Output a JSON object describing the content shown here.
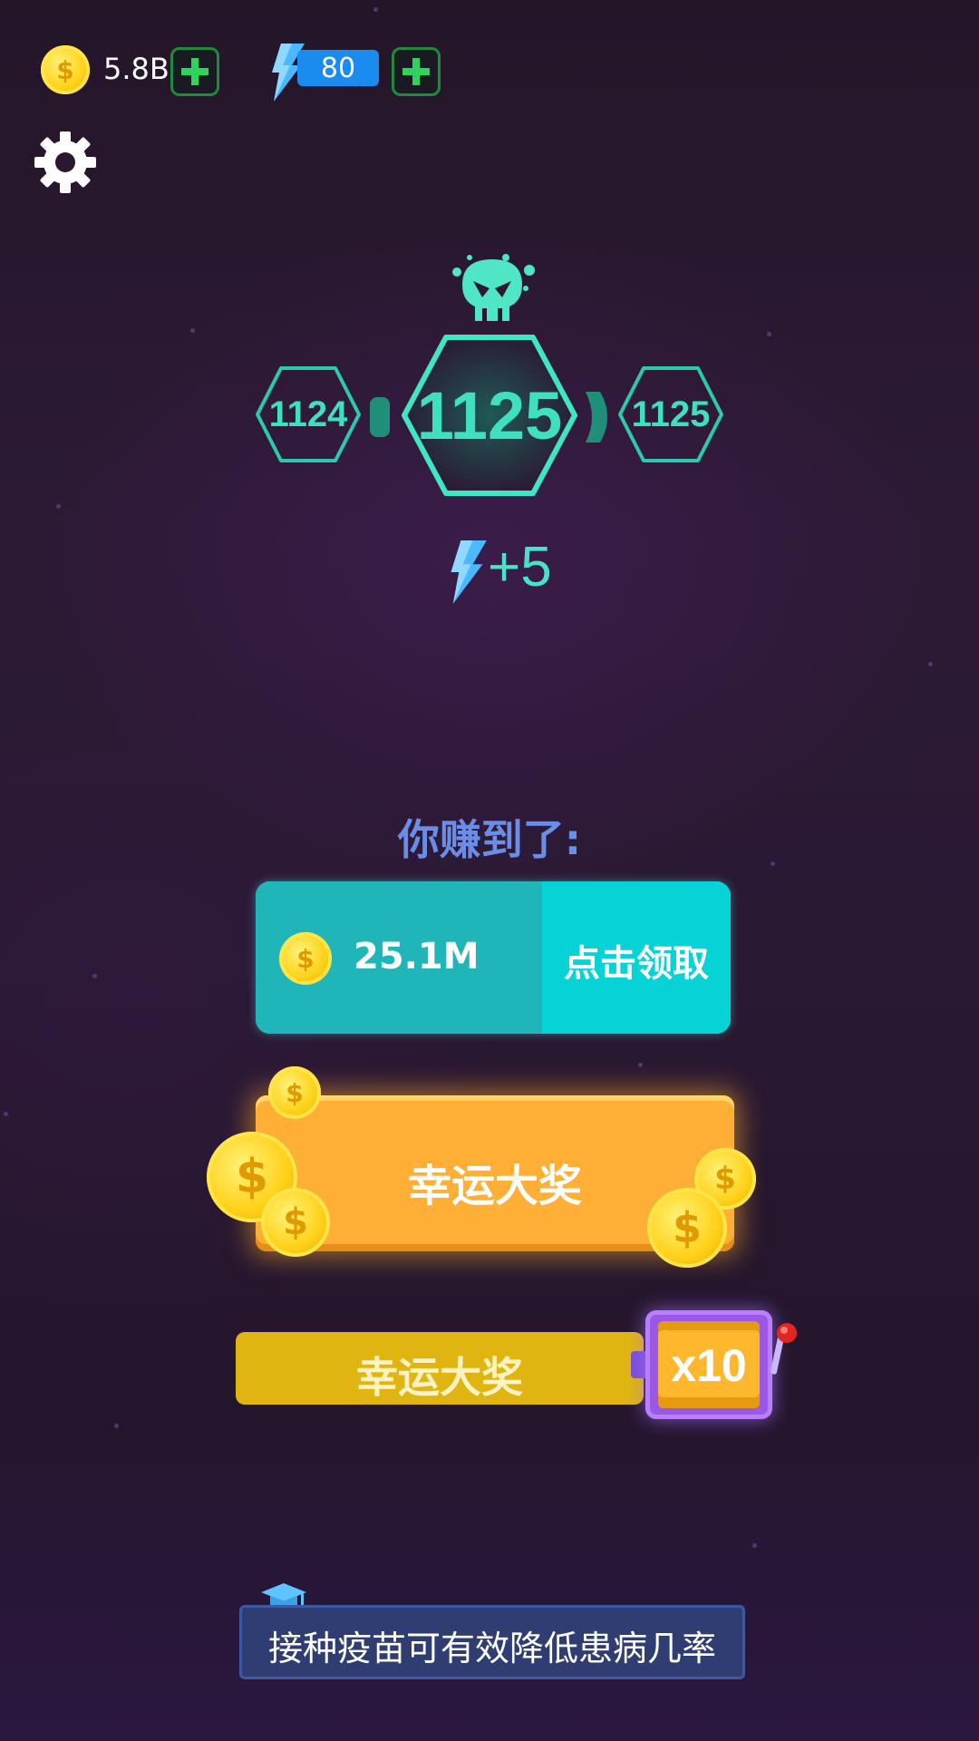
{
  "top_bar": {
    "coins": "5.8B",
    "energy": "80",
    "coin_add_icon": "plus-icon",
    "energy_add_icon": "plus-icon",
    "settings_icon": "gear-icon"
  },
  "level": {
    "boss_icon": "skull-icon",
    "previous": "1124",
    "current": "1125",
    "next": "1125",
    "reward": "+5"
  },
  "earned": {
    "title": "你赚到了:",
    "amount": "25.1M",
    "claim_label": "点击领取"
  },
  "lucky_button": {
    "label": "幸运大奖"
  },
  "slot": {
    "label": "幸运大奖",
    "multiplier": "x10"
  },
  "tip": {
    "icon": "graduation-cap-icon",
    "text": "接种疫苗可有效降低患病几率"
  },
  "colors": {
    "accent_teal": "#3fe0c0",
    "claim_box": "#07d3d6",
    "lucky_orange": "#ffae36",
    "slot_yellow": "#e0b512",
    "energy_blue": "#1a8cf0"
  }
}
